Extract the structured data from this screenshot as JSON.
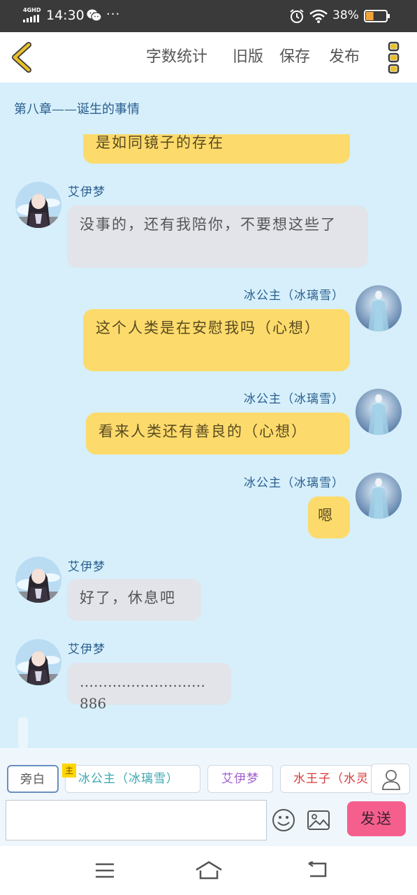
{
  "status_bar": {
    "network": "4GHD",
    "time": "14:30",
    "more": "···",
    "battery_percent": "38%",
    "icons": [
      "signal-icon",
      "wechat-icon",
      "alarm-icon",
      "wifi-icon",
      "battery-icon"
    ],
    "battery_level": 0.38
  },
  "toolbar": {
    "word_count": "字数统计",
    "old_version": "旧版",
    "save": "保存",
    "publish": "发布"
  },
  "chapter_title": "第八章——诞生的事情",
  "messages": [
    {
      "side": "right",
      "text": "是如同镜子的存在"
    },
    {
      "side": "left",
      "speaker": "艾伊梦",
      "text": "没事的，还有我陪你，不要想这些了"
    },
    {
      "side": "right",
      "speaker": "冰公主（冰璃雪）",
      "text": "这个人类是在安慰我吗（心想）"
    },
    {
      "side": "right",
      "speaker": "冰公主（冰璃雪）",
      "text": "看来人类还有善良的（心想）"
    },
    {
      "side": "right",
      "speaker": "冰公主（冰璃雪）",
      "text": "嗯"
    },
    {
      "side": "left",
      "speaker": "艾伊梦",
      "text": "好了，休息吧"
    },
    {
      "side": "left",
      "speaker": "艾伊梦",
      "text": "………………………886"
    }
  ],
  "roles": {
    "narrator": "旁白",
    "main_badge": "主",
    "ice_princess": "冰公主（冰璃雪）",
    "ai_yimeng": "艾伊梦",
    "water_prince": "水王子（水灵"
  },
  "input": {
    "value": "",
    "placeholder": ""
  },
  "send_button": "发送",
  "colors": {
    "chat_background": "#d6effb",
    "right_bubble": "#fcdb6c",
    "left_bubble": "#e2e4ea",
    "send_button": "#f55f8e",
    "accent_back": "#e8c02a"
  }
}
